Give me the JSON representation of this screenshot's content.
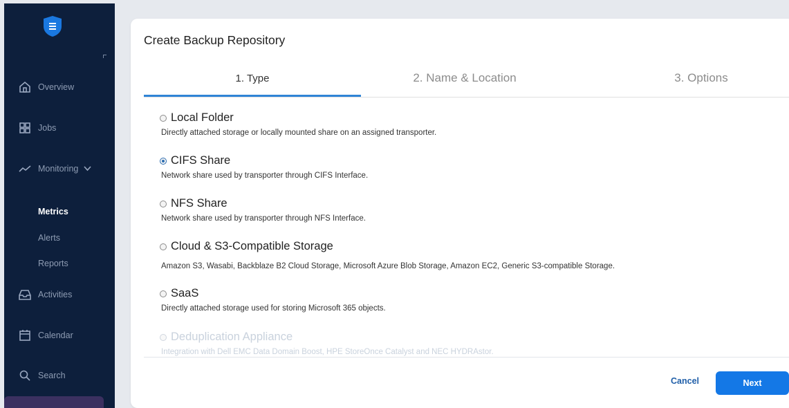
{
  "sidebar": {
    "nav": [
      {
        "label": "Overview",
        "icon": "home-icon"
      },
      {
        "label": "Jobs",
        "icon": "grid-icon"
      },
      {
        "label": "Monitoring",
        "icon": "activity-icon"
      },
      {
        "label": "Activities",
        "icon": "inbox-icon"
      },
      {
        "label": "Calendar",
        "icon": "calendar-icon"
      },
      {
        "label": "Search",
        "icon": "search-icon"
      }
    ],
    "monitoring_sub": [
      {
        "label": "Metrics",
        "active": true
      },
      {
        "label": "Alerts",
        "active": false
      },
      {
        "label": "Reports",
        "active": false
      }
    ]
  },
  "dialog": {
    "title": "Create Backup Repository",
    "tabs": [
      "1. Type",
      "2. Name & Location",
      "3. Options"
    ],
    "active_tab": "1. Type",
    "options": [
      {
        "title": "Local Folder",
        "desc": "Directly attached storage or locally mounted share on an assigned transporter.",
        "checked": false,
        "disabled": false
      },
      {
        "title": "CIFS Share",
        "desc": "Network share used by transporter through CIFS Interface.",
        "checked": true,
        "disabled": false
      },
      {
        "title": "NFS Share",
        "desc": "Network share used by transporter through NFS Interface.",
        "checked": false,
        "disabled": false
      },
      {
        "title": "Cloud & S3-Compatible Storage",
        "desc": "Amazon S3, Wasabi, Backblaze B2 Cloud Storage, Microsoft Azure Blob Storage, Amazon EC2, Generic S3-compatible Storage.",
        "checked": false,
        "disabled": false
      },
      {
        "title": "SaaS",
        "desc": "Directly attached storage used for storing Microsoft 365 objects.",
        "checked": false,
        "disabled": false
      },
      {
        "title": "Deduplication Appliance",
        "desc": "Integration with Dell EMC Data Domain Boost, HPE StoreOnce Catalyst and NEC HYDRAstor.",
        "checked": false,
        "disabled": true
      }
    ],
    "cancel_label": "Cancel",
    "next_label": "Next"
  },
  "colors": {
    "sidebar_bg": "#0d1f3c",
    "accent": "#1478e6",
    "tab_underline": "#2f84d6"
  }
}
